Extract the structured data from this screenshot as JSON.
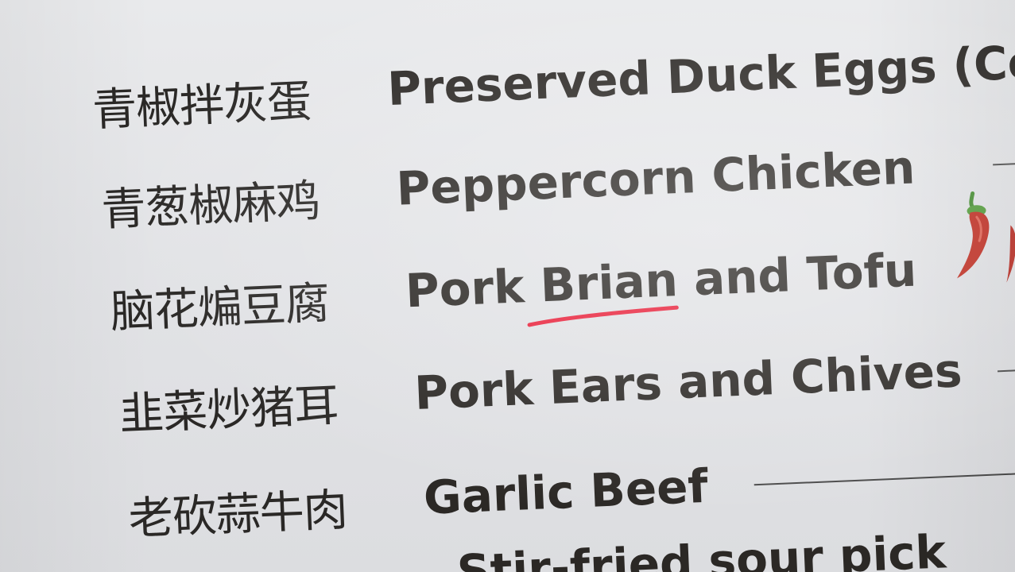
{
  "menu": {
    "top_cut_text": "",
    "items": [
      {
        "chinese": "青椒拌灰蛋",
        "english": "Preserved Duck Eggs (Co",
        "spicy": false
      },
      {
        "chinese": "青葱椒麻鸡",
        "english": "Peppercorn Chicken",
        "spicy": false
      },
      {
        "chinese": "脑花煸豆腐",
        "english": "Pork Brian and Tofu",
        "spicy": true
      },
      {
        "chinese": "韭菜炒猪耳",
        "english": "Pork Ears and Chives",
        "spicy": false
      },
      {
        "chinese": "老砍蒜牛肉",
        "english": "Garlic Beef",
        "spicy": false
      }
    ],
    "bottom_cut_text": "Stir-fried sour pick"
  },
  "annotation": {
    "underlined_word": "Brian",
    "underline_color": "#e8203a"
  },
  "colors": {
    "paper": "#e4e5e8",
    "ink": "#2a2826",
    "chili_red": "#c0281c",
    "chili_stem": "#3f8a2a"
  },
  "icons": {
    "spicy_marker": "chili-pepper-icon"
  }
}
